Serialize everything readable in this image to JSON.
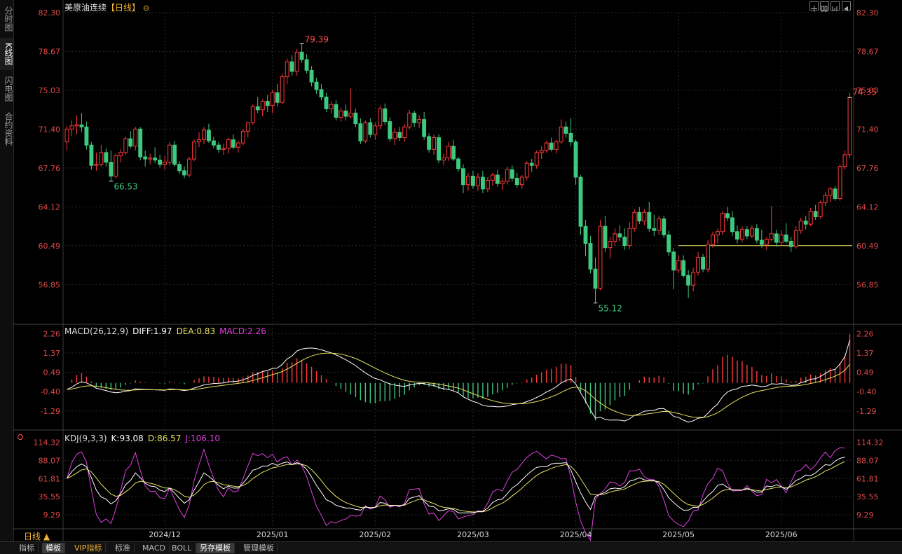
{
  "header": {
    "title": "美原油连续",
    "period_bracket": "【日线】",
    "zoom_icon": "zoom-circle-icon"
  },
  "toolbar_icons": [
    "crosshair-icon",
    "layout-icon",
    "layout-icon",
    "back-icon"
  ],
  "left_tabs": [
    {
      "label": "分时图",
      "active": false
    },
    {
      "label": "K线图",
      "active": true
    },
    {
      "label": "闪电图",
      "active": false
    },
    {
      "label": "合约资料",
      "active": false
    }
  ],
  "macd_legend": {
    "name": "MACD(26,12,9)",
    "diff": "DIFF:1.97",
    "dea": "DEA:0.83",
    "macd": "MACD:2.26"
  },
  "kdj_legend": {
    "name": "KDJ(9,3,3)",
    "k": "K:93.08",
    "d": "D:86.57",
    "j": "J:106.10"
  },
  "period_label": "日线 ▲",
  "bottom_tabs": [
    "指标",
    "模板",
    "VIP指标",
    "标准",
    "MACD",
    "BOLL",
    "另存模板",
    "管理模板"
  ],
  "colors": {
    "up": "#ff3b3b",
    "down": "#3ec97e",
    "grid": "#2a2a2a",
    "axis_text": "#e04848",
    "diff": "#ffffff",
    "dea": "#e6e060",
    "j_line": "#dd40dd",
    "hline": "#e6e060"
  },
  "chart_data": [
    {
      "type": "candlestick",
      "title": "美原油连续【日线】",
      "x_ticks": [
        "2024/12",
        "2025/01",
        "2025/02",
        "2025/03",
        "2025/04",
        "2025/05",
        "2025/06"
      ],
      "y_ticks": [
        "82.30",
        "78.67",
        "75.03",
        "71.40",
        "67.76",
        "64.12",
        "60.49",
        "56.85"
      ],
      "ylim": [
        53.2,
        82.3
      ],
      "annotations": {
        "high": "79.39",
        "low_dec": "66.53",
        "low_apr": "55.12",
        "last": "74.35"
      },
      "horizontal_line": 60.49,
      "ohlc": [
        [
          70.2,
          71.7,
          69.4,
          71.4
        ],
        [
          71.4,
          72.2,
          70.8,
          71.7
        ],
        [
          71.7,
          72.7,
          70.9,
          71.8
        ],
        [
          71.8,
          72.9,
          71.1,
          71.6
        ],
        [
          71.6,
          72.1,
          69.5,
          69.9
        ],
        [
          69.9,
          70.2,
          67.6,
          68.0
        ],
        [
          68.0,
          69.2,
          67.5,
          68.1
        ],
        [
          68.1,
          69.9,
          67.9,
          69.2
        ],
        [
          69.2,
          69.6,
          67.9,
          68.3
        ],
        [
          68.3,
          69.4,
          66.53,
          67.0
        ],
        [
          67.0,
          69.1,
          66.8,
          68.9
        ],
        [
          68.9,
          69.5,
          68.3,
          69.2
        ],
        [
          69.2,
          70.7,
          69.0,
          70.5
        ],
        [
          70.5,
          71.2,
          69.6,
          69.8
        ],
        [
          69.8,
          71.6,
          69.4,
          71.4
        ],
        [
          71.4,
          71.6,
          68.5,
          68.8
        ],
        [
          68.8,
          69.4,
          67.9,
          68.6
        ],
        [
          68.6,
          69.1,
          68.1,
          68.7
        ],
        [
          68.7,
          69.7,
          68.2,
          68.5
        ],
        [
          68.5,
          69.0,
          67.8,
          68.1
        ],
        [
          68.1,
          68.9,
          67.6,
          68.3
        ],
        [
          68.3,
          70.2,
          68.0,
          69.9
        ],
        [
          69.9,
          70.3,
          67.9,
          68.1
        ],
        [
          68.1,
          68.4,
          67.2,
          67.5
        ],
        [
          67.5,
          67.9,
          66.8,
          67.1
        ],
        [
          67.1,
          68.8,
          66.9,
          68.6
        ],
        [
          68.6,
          70.4,
          68.4,
          70.2
        ],
        [
          70.2,
          71.1,
          69.7,
          70.4
        ],
        [
          70.4,
          71.6,
          70.0,
          71.3
        ],
        [
          71.3,
          71.9,
          70.1,
          70.3
        ],
        [
          70.3,
          70.7,
          69.6,
          69.9
        ],
        [
          69.9,
          70.2,
          69.2,
          69.5
        ],
        [
          69.5,
          70.0,
          69.0,
          69.6
        ],
        [
          69.6,
          70.6,
          69.1,
          70.4
        ],
        [
          70.4,
          70.9,
          69.5,
          69.7
        ],
        [
          69.7,
          70.3,
          69.2,
          70.1
        ],
        [
          70.1,
          71.4,
          69.9,
          71.2
        ],
        [
          71.2,
          72.1,
          70.6,
          72.0
        ],
        [
          72.0,
          73.7,
          71.8,
          73.5
        ],
        [
          73.5,
          74.4,
          72.9,
          73.2
        ],
        [
          73.2,
          74.2,
          72.6,
          74.0
        ],
        [
          74.0,
          74.6,
          73.0,
          73.6
        ],
        [
          73.6,
          75.1,
          72.9,
          74.8
        ],
        [
          74.8,
          75.6,
          73.5,
          73.9
        ],
        [
          73.9,
          76.6,
          73.7,
          76.3
        ],
        [
          76.3,
          78.0,
          75.6,
          77.7
        ],
        [
          77.7,
          78.3,
          76.4,
          76.8
        ],
        [
          76.8,
          78.9,
          76.4,
          78.6
        ],
        [
          78.6,
          79.39,
          77.6,
          77.9
        ],
        [
          77.9,
          78.4,
          76.6,
          76.9
        ],
        [
          76.9,
          77.3,
          75.4,
          75.8
        ],
        [
          75.8,
          76.2,
          74.7,
          75.1
        ],
        [
          75.1,
          75.6,
          74.1,
          74.4
        ],
        [
          74.4,
          74.8,
          73.0,
          73.3
        ],
        [
          73.3,
          74.0,
          72.9,
          73.7
        ],
        [
          73.7,
          74.1,
          72.2,
          72.5
        ],
        [
          72.5,
          73.4,
          72.1,
          73.1
        ],
        [
          73.1,
          73.7,
          72.2,
          72.6
        ],
        [
          72.6,
          75.2,
          72.4,
          72.9
        ],
        [
          72.9,
          73.3,
          71.6,
          71.9
        ],
        [
          71.9,
          72.4,
          70.0,
          70.3
        ],
        [
          70.3,
          72.2,
          70.1,
          72.0
        ],
        [
          72.0,
          72.4,
          70.6,
          70.9
        ],
        [
          70.9,
          72.0,
          70.4,
          71.7
        ],
        [
          71.7,
          73.6,
          71.4,
          73.3
        ],
        [
          73.3,
          73.8,
          71.8,
          72.1
        ],
        [
          72.1,
          72.5,
          70.2,
          70.5
        ],
        [
          70.5,
          71.5,
          69.9,
          71.1
        ],
        [
          71.1,
          71.6,
          70.3,
          70.6
        ],
        [
          70.6,
          71.9,
          70.2,
          71.6
        ],
        [
          71.6,
          73.2,
          71.4,
          72.9
        ],
        [
          72.9,
          73.1,
          71.6,
          72.0
        ],
        [
          72.0,
          72.7,
          71.5,
          72.3
        ],
        [
          72.3,
          73.0,
          70.4,
          70.7
        ],
        [
          70.7,
          71.0,
          69.2,
          69.5
        ],
        [
          69.5,
          70.9,
          69.0,
          70.6
        ],
        [
          70.6,
          70.9,
          68.2,
          68.5
        ],
        [
          68.5,
          69.1,
          68.0,
          68.7
        ],
        [
          68.7,
          70.2,
          68.4,
          69.8
        ],
        [
          69.8,
          70.4,
          68.4,
          68.6
        ],
        [
          68.6,
          68.8,
          67.4,
          67.7
        ],
        [
          67.7,
          68.1,
          65.4,
          66.2
        ],
        [
          66.2,
          67.3,
          65.6,
          67.0
        ],
        [
          67.0,
          67.5,
          65.8,
          66.1
        ],
        [
          66.1,
          67.3,
          65.6,
          66.9
        ],
        [
          66.9,
          67.5,
          65.4,
          65.8
        ],
        [
          65.8,
          66.9,
          65.5,
          66.6
        ],
        [
          66.6,
          67.3,
          66.1,
          67.1
        ],
        [
          67.1,
          67.6,
          66.0,
          66.3
        ],
        [
          66.3,
          66.8,
          65.7,
          66.5
        ],
        [
          66.5,
          67.9,
          66.2,
          67.6
        ],
        [
          67.6,
          68.0,
          66.5,
          66.8
        ],
        [
          66.8,
          67.3,
          65.9,
          66.2
        ],
        [
          66.2,
          67.1,
          65.8,
          66.9
        ],
        [
          66.9,
          68.4,
          66.6,
          68.2
        ],
        [
          68.2,
          68.6,
          67.4,
          68.0
        ],
        [
          68.0,
          69.4,
          67.7,
          69.2
        ],
        [
          69.2,
          69.8,
          68.6,
          69.4
        ],
        [
          69.4,
          70.3,
          69.2,
          70.1
        ],
        [
          70.1,
          70.6,
          69.3,
          69.5
        ],
        [
          69.5,
          70.4,
          69.1,
          70.2
        ],
        [
          70.2,
          72.3,
          70.0,
          71.6
        ],
        [
          71.6,
          72.1,
          70.6,
          71.0
        ],
        [
          71.0,
          72.4,
          69.8,
          70.2
        ],
        [
          70.2,
          70.4,
          66.2,
          66.9
        ],
        [
          66.9,
          67.1,
          61.5,
          62.3
        ],
        [
          62.3,
          62.9,
          59.5,
          60.7
        ],
        [
          60.7,
          61.4,
          57.9,
          58.3
        ],
        [
          58.3,
          59.4,
          55.12,
          56.5
        ],
        [
          56.5,
          62.9,
          56.3,
          62.3
        ],
        [
          62.3,
          63.3,
          59.9,
          60.3
        ],
        [
          60.3,
          61.3,
          59.3,
          60.9
        ],
        [
          60.9,
          62.1,
          60.5,
          61.6
        ],
        [
          61.6,
          62.4,
          60.9,
          61.3
        ],
        [
          61.3,
          62.1,
          60.1,
          60.5
        ],
        [
          60.5,
          62.7,
          60.2,
          62.1
        ],
        [
          62.1,
          63.9,
          61.8,
          63.6
        ],
        [
          63.6,
          64.1,
          62.5,
          62.8
        ],
        [
          62.8,
          63.9,
          62.4,
          63.6
        ],
        [
          63.6,
          64.6,
          61.8,
          62.1
        ],
        [
          62.1,
          63.4,
          61.4,
          61.9
        ],
        [
          61.9,
          63.3,
          61.5,
          63.0
        ],
        [
          63.0,
          63.3,
          61.2,
          61.5
        ],
        [
          61.5,
          61.9,
          59.5,
          59.9
        ],
        [
          59.9,
          60.3,
          56.4,
          58.2
        ],
        [
          58.2,
          59.6,
          57.9,
          59.1
        ],
        [
          59.1,
          59.6,
          57.5,
          57.7
        ],
        [
          57.7,
          58.2,
          55.6,
          56.8
        ],
        [
          56.8,
          58.4,
          56.2,
          58.0
        ],
        [
          58.0,
          59.9,
          57.7,
          59.4
        ],
        [
          59.4,
          59.7,
          58.0,
          58.3
        ],
        [
          58.3,
          61.0,
          58.0,
          60.6
        ],
        [
          60.6,
          61.8,
          60.3,
          61.5
        ],
        [
          61.5,
          62.1,
          60.7,
          61.8
        ],
        [
          61.8,
          63.7,
          61.5,
          63.5
        ],
        [
          63.5,
          64.1,
          62.8,
          63.1
        ],
        [
          63.1,
          63.7,
          61.4,
          61.8
        ],
        [
          61.8,
          62.4,
          60.7,
          61.1
        ],
        [
          61.1,
          62.3,
          60.8,
          62.0
        ],
        [
          62.0,
          62.3,
          61.1,
          61.4
        ],
        [
          61.4,
          62.4,
          61.2,
          62.1
        ],
        [
          62.1,
          62.5,
          60.7,
          61.0
        ],
        [
          61.0,
          62.0,
          60.3,
          60.6
        ],
        [
          60.6,
          61.3,
          60.1,
          61.1
        ],
        [
          61.1,
          64.2,
          60.9,
          61.6
        ],
        [
          61.6,
          62.0,
          60.4,
          60.8
        ],
        [
          60.8,
          61.9,
          60.5,
          61.5
        ],
        [
          61.5,
          62.6,
          60.7,
          60.9
        ],
        [
          60.9,
          61.3,
          59.9,
          60.4
        ],
        [
          60.4,
          62.3,
          60.2,
          61.9
        ],
        [
          61.9,
          63.1,
          61.6,
          62.8
        ],
        [
          62.8,
          63.3,
          62.0,
          62.5
        ],
        [
          62.5,
          64.0,
          62.3,
          63.7
        ],
        [
          63.7,
          64.3,
          62.9,
          63.2
        ],
        [
          63.2,
          64.7,
          63.0,
          64.5
        ],
        [
          64.5,
          65.5,
          64.2,
          65.2
        ],
        [
          65.2,
          66.0,
          64.6,
          65.8
        ],
        [
          65.8,
          66.1,
          64.7,
          64.9
        ],
        [
          64.9,
          68.1,
          64.7,
          67.9
        ],
        [
          67.9,
          69.4,
          67.6,
          69.0
        ],
        [
          69.0,
          74.8,
          68.7,
          74.35
        ]
      ]
    },
    {
      "type": "macd",
      "y_ticks": [
        "2.26",
        "1.37",
        "0.49",
        "-0.40",
        "-1.29"
      ],
      "ylim": [
        -2.1,
        2.4
      ],
      "diff": [
        -0.3,
        -0.2,
        -0.05,
        0.05,
        0.0,
        -0.1,
        -0.25,
        -0.3,
        -0.35,
        -0.42,
        -0.45,
        -0.43,
        -0.38,
        -0.35,
        -0.27,
        -0.29,
        -0.3,
        -0.31,
        -0.32,
        -0.33,
        -0.34,
        -0.28,
        -0.29,
        -0.32,
        -0.35,
        -0.32,
        -0.24,
        -0.17,
        -0.09,
        -0.06,
        -0.03,
        -0.02,
        0.0,
        0.05,
        0.06,
        0.08,
        0.14,
        0.22,
        0.35,
        0.42,
        0.52,
        0.57,
        0.66,
        0.68,
        0.85,
        1.1,
        1.23,
        1.46,
        1.55,
        1.59,
        1.6,
        1.57,
        1.52,
        1.45,
        1.38,
        1.28,
        1.18,
        1.06,
        0.93,
        0.79,
        0.62,
        0.46,
        0.32,
        0.2,
        0.14,
        0.04,
        -0.05,
        -0.1,
        -0.14,
        -0.16,
        -0.1,
        -0.06,
        -0.02,
        -0.03,
        -0.09,
        -0.12,
        -0.21,
        -0.27,
        -0.3,
        -0.37,
        -0.46,
        -0.64,
        -0.75,
        -0.85,
        -0.92,
        -1.03,
        -1.07,
        -1.08,
        -1.1,
        -1.09,
        -1.06,
        -1.0,
        -0.97,
        -0.94,
        -0.86,
        -0.78,
        -0.67,
        -0.56,
        -0.42,
        -0.32,
        -0.18,
        0.0,
        0.11,
        0.18,
        -0.06,
        -0.45,
        -0.84,
        -1.25,
        -1.62,
        -1.57,
        -1.68,
        -1.71,
        -1.7,
        -1.71,
        -1.75,
        -1.65,
        -1.49,
        -1.42,
        -1.3,
        -1.28,
        -1.26,
        -1.18,
        -1.18,
        -1.33,
        -1.54,
        -1.59,
        -1.71,
        -1.8,
        -1.74,
        -1.62,
        -1.6,
        -1.4,
        -1.16,
        -0.97,
        -0.63,
        -0.42,
        -0.32,
        -0.27,
        -0.16,
        -0.14,
        -0.1,
        -0.13,
        -0.17,
        -0.15,
        -0.04,
        -0.06,
        -0.03,
        -0.07,
        -0.12,
        -0.1,
        0.01,
        0.07,
        0.17,
        0.19,
        0.29,
        0.43,
        0.57,
        0.62,
        0.87,
        1.2,
        1.97
      ]
    },
    {
      "type": "kdj",
      "y_ticks": [
        "114.32",
        "88.07",
        "61.81",
        "35.55",
        "9.29"
      ],
      "ylim": [
        -8,
        120
      ],
      "k": [
        62,
        72,
        79,
        83,
        79,
        63,
        45,
        35,
        32,
        25,
        30,
        40,
        53,
        59,
        70,
        63,
        55,
        51,
        50,
        45,
        43,
        48,
        41,
        33,
        26,
        31,
        45,
        57,
        70,
        65,
        59,
        52,
        47,
        51,
        48,
        48,
        55,
        64,
        74,
        76,
        80,
        80,
        84,
        81,
        84,
        86,
        82,
        85,
        82,
        75,
        64,
        52,
        42,
        31,
        28,
        23,
        21,
        19,
        19,
        17,
        16,
        21,
        19,
        20,
        27,
        26,
        22,
        23,
        22,
        24,
        33,
        35,
        37,
        29,
        22,
        21,
        15,
        16,
        18,
        17,
        12,
        12,
        12,
        12,
        14,
        14,
        19,
        27,
        31,
        32,
        40,
        48,
        53,
        60,
        67,
        73,
        78,
        79,
        79,
        83,
        84,
        84,
        85,
        74,
        57,
        41,
        28,
        17,
        36,
        39,
        42,
        47,
        48,
        47,
        50,
        58,
        60,
        63,
        60,
        59,
        59,
        55,
        46,
        34,
        27,
        21,
        16,
        16,
        20,
        20,
        29,
        37,
        43,
        52,
        54,
        49,
        45,
        45,
        45,
        48,
        45,
        42,
        42,
        51,
        50,
        53,
        50,
        46,
        52,
        59,
        62,
        67,
        66,
        70,
        76,
        82,
        81,
        87,
        91,
        93
      ]
    }
  ]
}
